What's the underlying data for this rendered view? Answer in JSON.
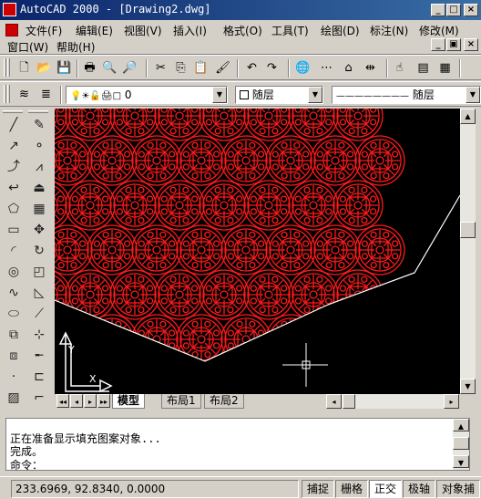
{
  "window": {
    "title": "AutoCAD 2000 - [Drawing2.dwg]",
    "btn_min": "_",
    "btn_max": "□",
    "btn_close": "×",
    "doc_btn_min": "_",
    "doc_btn_restore": "▣",
    "doc_btn_close": "×"
  },
  "menu": {
    "items": [
      "文件(F)",
      "编辑(E)",
      "视图(V)",
      "插入(I)",
      "格式(O)",
      "工具(T)",
      "绘图(D)",
      "标注(N)",
      "修改(M)",
      "窗口(W)",
      "帮助(H)"
    ]
  },
  "toolbar": {
    "icons": [
      "new-icon",
      "open-icon",
      "save-icon",
      "print-icon",
      "preview-icon",
      "find-icon",
      "cut-icon",
      "copy-icon",
      "paste-icon",
      "match-icon",
      "undo-icon",
      "redo-icon",
      "web-icon",
      "snap-track-icon",
      "ucs-icon",
      "distance-icon",
      "pan-icon",
      "properties-icon",
      "design-center-icon"
    ],
    "glyphs": [
      "🗋",
      "📂",
      "💾",
      "🖶",
      "🔍",
      "🔎",
      "✂",
      "⎘",
      "📋",
      "🖌",
      "↶",
      "↷",
      "🌐",
      "⋯",
      "⌂",
      "⇹",
      "☝",
      "▤",
      "▦"
    ]
  },
  "layer": {
    "current": "0",
    "color": "随层",
    "linetype_line": "————————",
    "linetype": "随层",
    "layer_mgr_glyph": "≋",
    "layer_prev_glyph": "≣",
    "state_glyphs": "💡☀🔓🖨□"
  },
  "draw_tools": {
    "icons": [
      "line-icon",
      "xline-icon",
      "pline-icon",
      "spline-undo-icon",
      "polygon-icon",
      "rectangle-icon",
      "arc-icon",
      "circle-icon",
      "revcloud-icon",
      "ellipse-icon",
      "block-icon",
      "insert-icon",
      "point-icon",
      "hatch-icon"
    ],
    "glyphs": [
      "╱",
      "↗",
      "⤴",
      "↩",
      "⬠",
      "▭",
      "◜",
      "◎",
      "∿",
      "⬭",
      "⧉",
      "⧈",
      "·",
      "▨"
    ]
  },
  "modify_tools": {
    "icons": [
      "erase-icon",
      "copy-obj-icon",
      "mirror-icon",
      "offset-icon",
      "array-icon",
      "move-icon",
      "rotate-icon",
      "scale-icon",
      "stretch-icon",
      "lengthen-icon",
      "trim-icon",
      "extend-icon",
      "break-icon",
      "chamfer-icon"
    ],
    "glyphs": [
      "✎",
      "⚬",
      "⩘",
      "⏏",
      "▦",
      "✥",
      "↻",
      "◰",
      "◺",
      "⟋",
      "⊹",
      "╾",
      "⊏",
      "⌐"
    ]
  },
  "tabs": [
    "模型",
    "布局1",
    "布局2"
  ],
  "tab_nav": [
    "◂◂",
    "◂",
    "▸",
    "▸▸"
  ],
  "scroll": {
    "up": "▲",
    "down": "▼",
    "left": "◂",
    "right": "▸"
  },
  "command": {
    "lines": [
      "正在准备显示填充图案对象...",
      "完成。"
    ],
    "prompt": "命令："
  },
  "status": {
    "coords": "233.6969, 92.8340, 0.0000",
    "toggles": [
      "捕捉",
      "栅格",
      "正交",
      "极轴",
      "对象捕"
    ]
  },
  "ucs": {
    "x_label": "X",
    "y_label": "Y"
  },
  "colors": {
    "hatch": "#ff1a1a",
    "canvas": "#000000",
    "title_start": "#0a246a",
    "title_end": "#3a6ea5"
  }
}
